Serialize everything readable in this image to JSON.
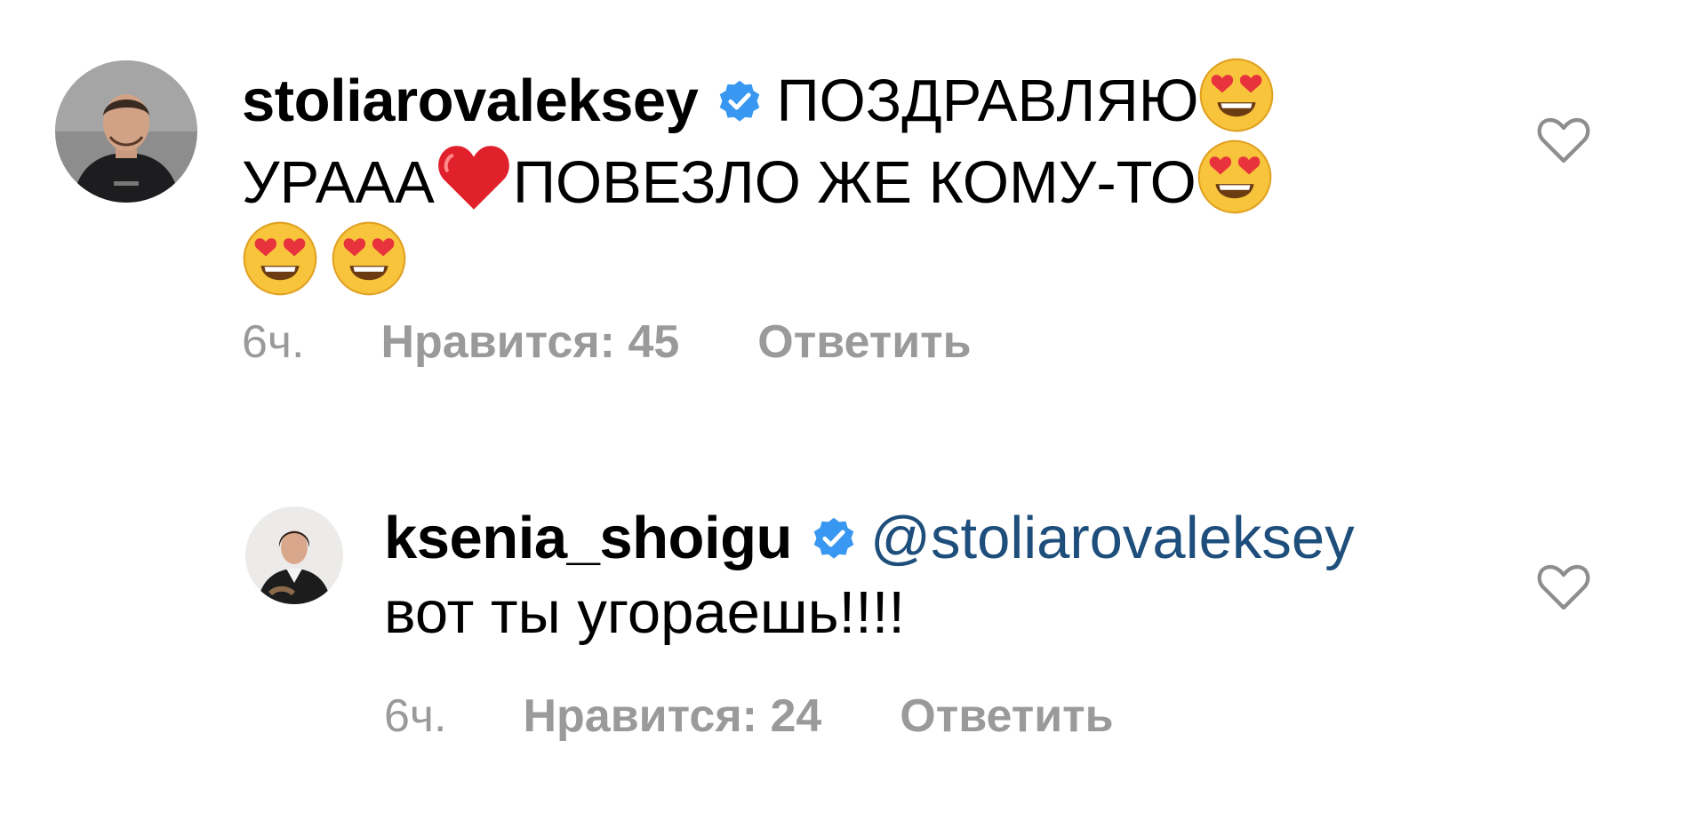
{
  "comments": [
    {
      "username": "stoliarovaleksey",
      "verified": true,
      "text_line1": "ПОЗДРАВЛЯЮ",
      "text_line2_a": "УРААА",
      "text_line2_b": "ПОВЕЗЛО ЖЕ КОМУ-ТО",
      "emojis": [
        "heart-eyes-emoji",
        "red-heart-emoji",
        "heart-eyes-emoji",
        "heart-eyes-emoji",
        "heart-eyes-emoji"
      ],
      "time": "6ч.",
      "likes_label": "Нравится: 45",
      "reply_label": "Ответить"
    },
    {
      "username": "ksenia_shoigu",
      "verified": true,
      "mention": "@stoliarovaleksey",
      "text": "вот ты угораешь!!!!",
      "time": "6ч.",
      "likes_label": "Нравится: 24",
      "reply_label": "Ответить"
    }
  ],
  "icons": {
    "verified": "verified-badge-icon",
    "like": "heart-outline-icon"
  },
  "colors": {
    "verified_blue": "#3897f0",
    "mention": "#1e4e7c",
    "meta_gray": "#9a9a9a",
    "heart_red": "#e0202a",
    "emoji_yellow": "#f7c43c"
  }
}
